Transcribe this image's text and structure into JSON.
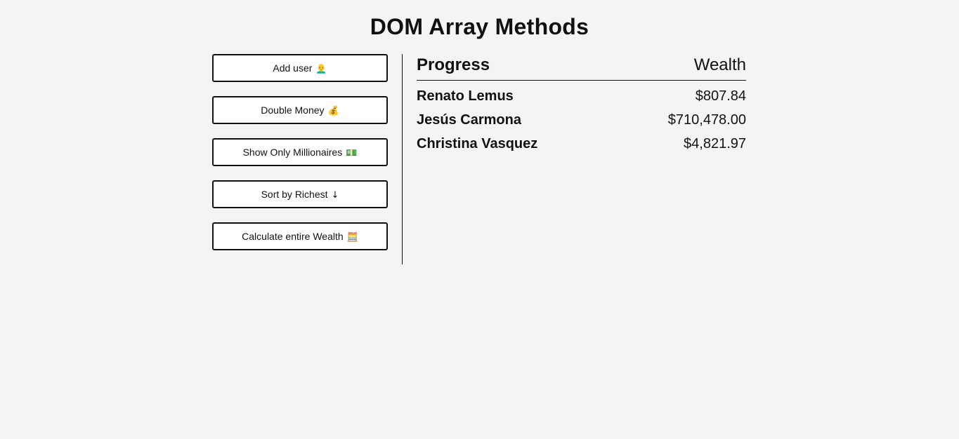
{
  "page": {
    "title": "DOM Array Methods"
  },
  "buttons": [
    {
      "label": "Add user",
      "icon": "👨‍🦲",
      "icon_name": "person-icon"
    },
    {
      "label": "Double Money",
      "icon": "💰",
      "icon_name": "money-bag-icon"
    },
    {
      "label": "Show Only Millionaires",
      "icon": "💵",
      "icon_name": "dollar-bill-icon"
    },
    {
      "label": "Sort by Richest",
      "icon": "↓",
      "icon_name": "arrow-down-icon"
    },
    {
      "label": "Calculate entire Wealth",
      "icon": "🧮",
      "icon_name": "abacus-icon"
    }
  ],
  "table": {
    "header_left": "Progress",
    "header_right": "Wealth",
    "rows": [
      {
        "name": "Renato Lemus",
        "wealth": "$807.84"
      },
      {
        "name": "Jesús Carmona",
        "wealth": "$710,478.00"
      },
      {
        "name": "Christina Vasquez",
        "wealth": "$4,821.97"
      }
    ]
  }
}
